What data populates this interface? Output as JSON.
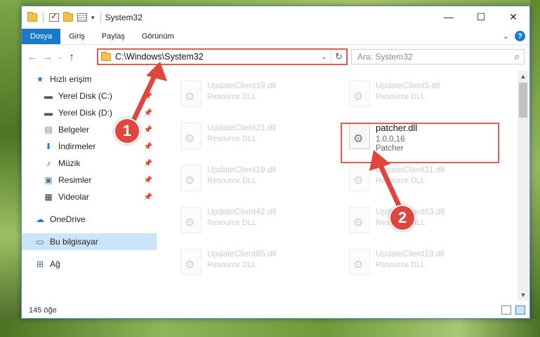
{
  "window": {
    "title": "System32",
    "minimize": "—",
    "maximize": "☐",
    "close": "✕"
  },
  "ribbon": {
    "tabs": [
      "Dosya",
      "Giriş",
      "Paylaş",
      "Görünüm"
    ],
    "expand": "⌄",
    "help": "?"
  },
  "nav": {
    "back": "←",
    "forward": "→",
    "recent": "⌄",
    "up": "↑",
    "address": "C:\\Windows\\System32",
    "address_dropdown": "⌄",
    "refresh": "↻",
    "search_placeholder": "Ara: System32",
    "search_icon": "⌕"
  },
  "sidebar": {
    "items": [
      {
        "label": "Hızlı erişim",
        "icon": "star-icon"
      },
      {
        "label": "Yerel Disk (C:)",
        "icon": "drive-icon"
      },
      {
        "label": "Yerel Disk (D:)",
        "icon": "drive-icon"
      },
      {
        "label": "Belgeler",
        "icon": "documents-icon"
      },
      {
        "label": "İndirmeler",
        "icon": "download-icon"
      },
      {
        "label": "Müzik",
        "icon": "music-icon"
      },
      {
        "label": "Resimler",
        "icon": "pictures-icon"
      },
      {
        "label": "Videolar",
        "icon": "video-icon"
      },
      {
        "label": "OneDrive",
        "icon": "cloud-icon"
      },
      {
        "label": "Bu bilgisayar",
        "icon": "computer-icon"
      },
      {
        "label": "Ağ",
        "icon": "network-icon"
      }
    ]
  },
  "files": [
    {
      "name": "UpdateClient19.dll",
      "sub": "Resource DLL"
    },
    {
      "name": "UpdateClient5.dll",
      "sub": "Resource DLL"
    },
    {
      "name": "UpdateClient21.dll",
      "sub": "Resource DLL"
    },
    {
      "name": "patcher.dll",
      "sub": "1,0,0,16",
      "sub2": "Patcher"
    },
    {
      "name": "UpdateClient19.dll",
      "sub": "Resource DLL"
    },
    {
      "name": "UpdateClient21.dll",
      "sub": "Resource DLL"
    },
    {
      "name": "UpdateClient42.dll",
      "sub": "Resource DLL"
    },
    {
      "name": "UpdateClient63.dll",
      "sub": "Resource DLL"
    },
    {
      "name": "UpdateClient65.dll",
      "sub": "Resource DLL"
    },
    {
      "name": "UpdateClient19.dll",
      "sub": "Resource DLL"
    }
  ],
  "status": {
    "count": "145 öğe"
  },
  "callouts": [
    "1",
    "2"
  ],
  "colors": {
    "accent": "#1979ca",
    "highlight": "#e15a53"
  }
}
